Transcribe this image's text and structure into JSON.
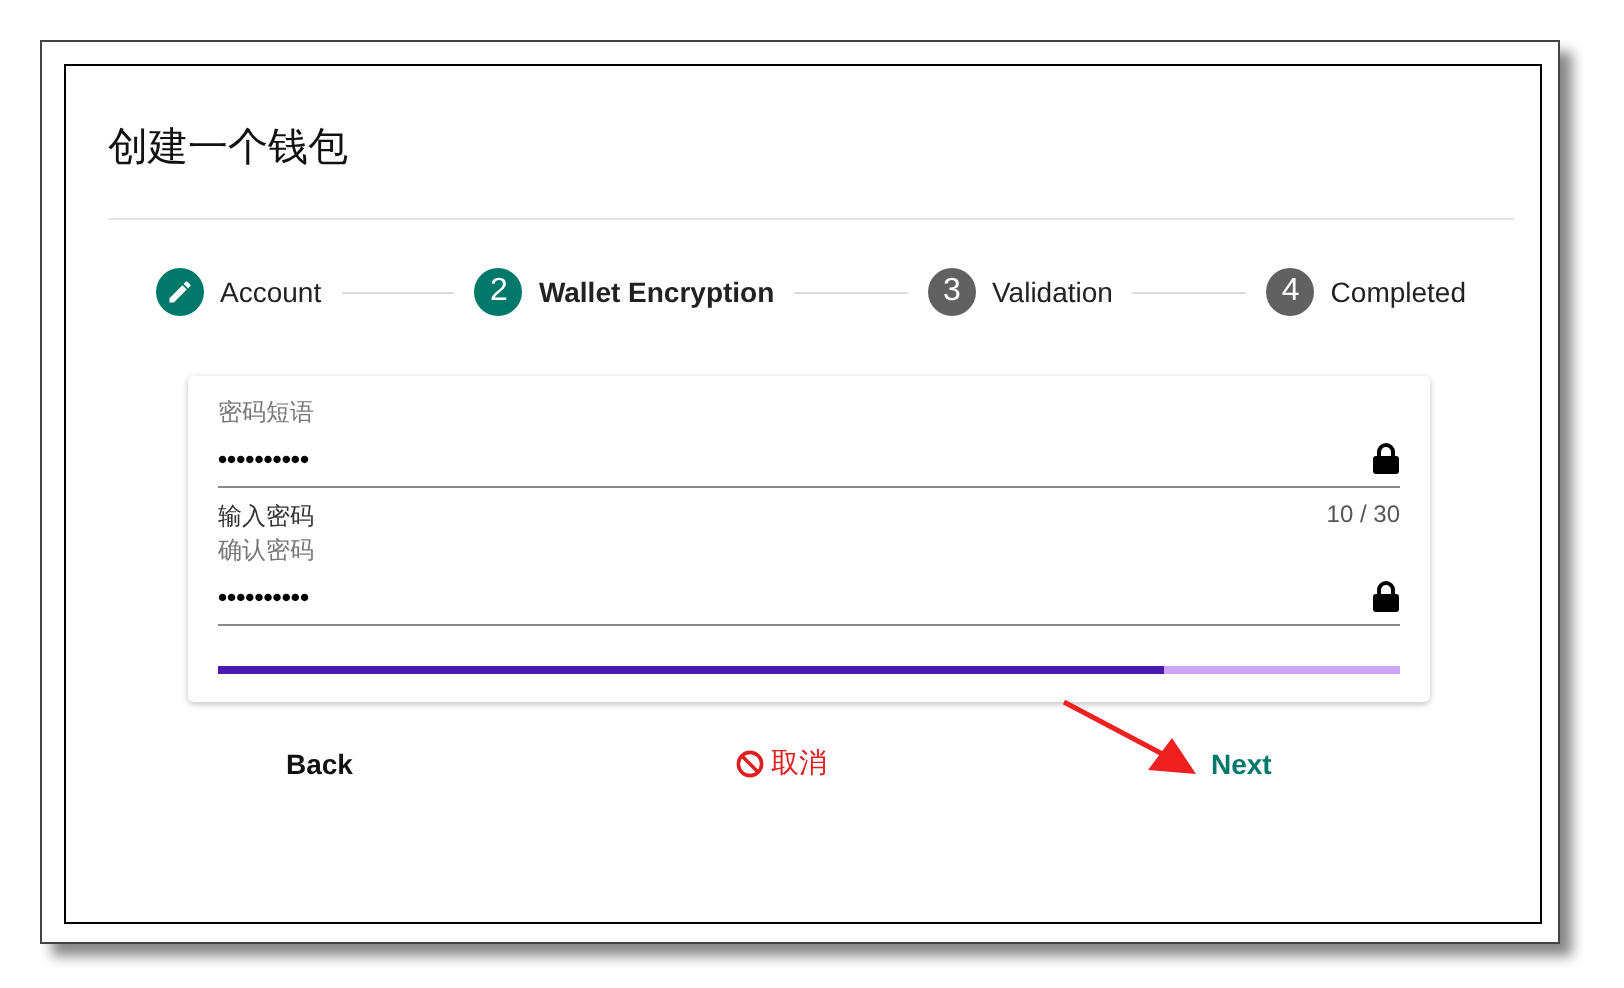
{
  "title": "创建一个钱包",
  "steps": [
    {
      "label": "Account",
      "kind": "done",
      "selected": false
    },
    {
      "label": "Wallet Encryption",
      "kind": "numbered",
      "number": "2",
      "selected": true
    },
    {
      "label": "Validation",
      "kind": "numbered",
      "number": "3",
      "selected": false
    },
    {
      "label": "Completed",
      "kind": "numbered",
      "number": "4",
      "selected": false
    }
  ],
  "fields": [
    {
      "label": "密码短语",
      "value": "••••••••••"
    },
    {
      "hint": "输入密码",
      "counter": "10 / 30",
      "label": "确认密码",
      "value": "••••••••••"
    }
  ],
  "strength": {
    "level": 0.8
  },
  "buttons": [
    {
      "label": "Back",
      "kind": "back"
    },
    {
      "label": "取消",
      "kind": "cancel"
    },
    {
      "label": "Next",
      "kind": "next"
    }
  ]
}
